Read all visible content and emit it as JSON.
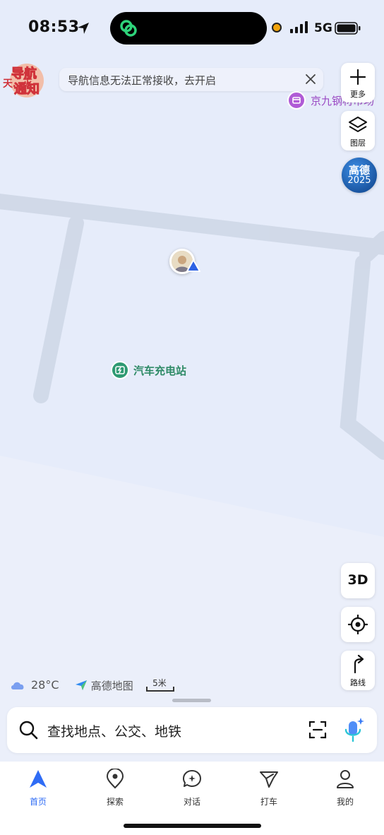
{
  "status_bar": {
    "time": "08:53",
    "network": "5G"
  },
  "promo": {
    "line1": "导航",
    "line2": "通知",
    "under_text": "天…灭"
  },
  "notice": {
    "text": "导航信息无法正常接收，去开启"
  },
  "map": {
    "poi_market": "京九钢材市场",
    "poi_charge": "汽车充电站"
  },
  "controls": {
    "more_label": "更多",
    "layers_label": "图层",
    "badge_line1": "高德",
    "badge_line2": "2025",
    "btn_3d": "3D",
    "route_label": "路线"
  },
  "info": {
    "temperature": "28°C",
    "logo_text": "高德地图",
    "scale_text": "5米"
  },
  "search": {
    "placeholder": "查找地点、公交、地铁"
  },
  "tabs": [
    {
      "label": "首页",
      "icon": "navigation-arrow-icon",
      "active": true
    },
    {
      "label": "探索",
      "icon": "map-pin-icon"
    },
    {
      "label": "对话",
      "icon": "chat-bubble-icon"
    },
    {
      "label": "打车",
      "icon": "taxi-icon"
    },
    {
      "label": "我的",
      "icon": "user-icon"
    }
  ],
  "colors": {
    "accent": "#2f6cf5",
    "map_bg": "#e6ecfa",
    "road": "#d3dbe9",
    "poi_green": "#2e9a72",
    "poi_purple": "#b05bd6"
  }
}
